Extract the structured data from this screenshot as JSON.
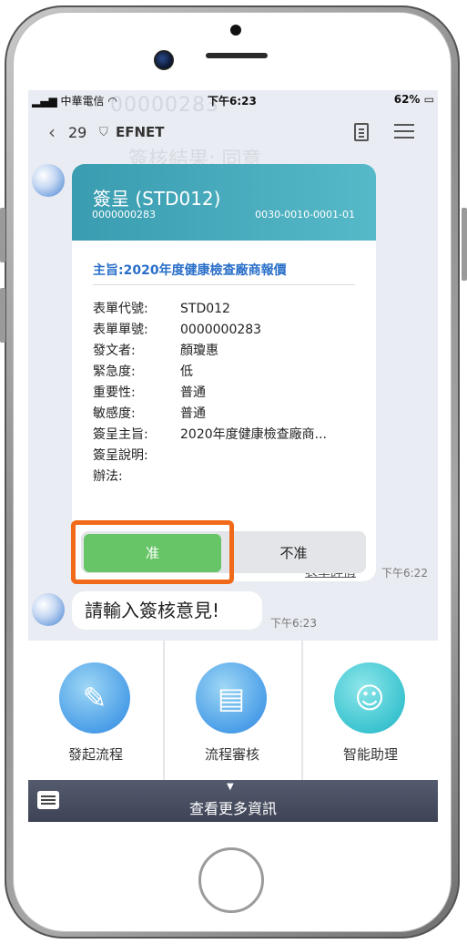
{
  "status": {
    "carrier": "中華電信",
    "time": "下午6:23",
    "battery": "62%"
  },
  "ghost_text": {
    "top": "00000283",
    "second": "簽核結果: 同意"
  },
  "navbar": {
    "back_count": "29",
    "title": "EFNET"
  },
  "card": {
    "title": "簽呈 (STD012)",
    "number": "0000000283",
    "code": "0030-0010-0001-01",
    "subject": "主旨:2020年度健康檢查廠商報價",
    "fields": [
      {
        "label": "表單代號:",
        "value": "STD012"
      },
      {
        "label": "表單單號:",
        "value": "0000000283"
      },
      {
        "label": "發文者:",
        "value": "顏瓊惠"
      },
      {
        "label": "緊急度:",
        "value": "低"
      },
      {
        "label": "重要性:",
        "value": "普通"
      },
      {
        "label": "敏感度:",
        "value": "普通"
      },
      {
        "label": "簽呈主旨:",
        "value": "2020年度健康檢查廠商..."
      },
      {
        "label": "簽呈說明:",
        "value": ""
      },
      {
        "label": "辦法:",
        "value": ""
      }
    ],
    "detail_link": "表單詳情",
    "approve_label": "准",
    "reject_label": "不准",
    "time": "下午6:22"
  },
  "message": {
    "text": "請輸入簽核意見!",
    "time": "下午6:23"
  },
  "actions": [
    {
      "label": "發起流程",
      "icon": "edit-document-icon"
    },
    {
      "label": "流程審核",
      "icon": "approval-stamp-icon"
    },
    {
      "label": "智能助理",
      "icon": "robot-icon"
    }
  ],
  "bottom": {
    "label": "查看更多資訊"
  },
  "colors": {
    "header": "#3a9cb0",
    "approve": "#67c567",
    "highlight": "#f06a1a"
  }
}
